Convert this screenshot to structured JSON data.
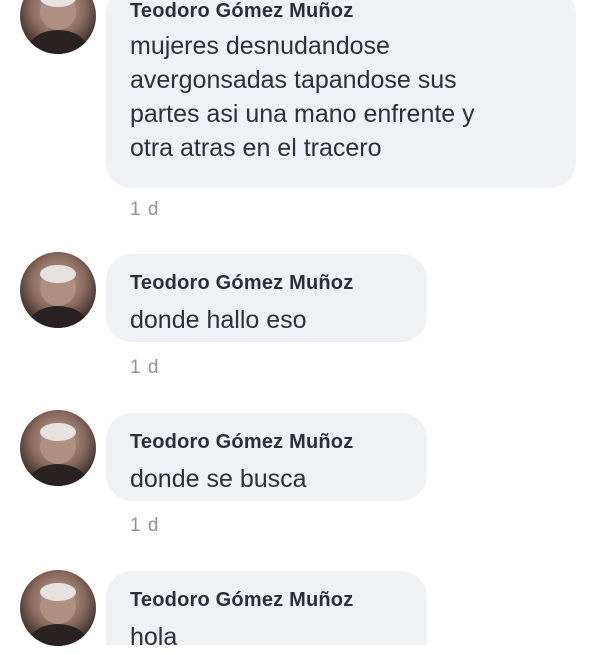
{
  "comments": [
    {
      "author": "Teodoro Gómez Muñoz",
      "text": "mujeres desnudandose\navergonsadas tapandose sus\npartes asi una mano enfrente y\notra atras en el tracero",
      "time": "1 d"
    },
    {
      "author": "Teodoro Gómez Muñoz",
      "text": "donde hallo eso",
      "time": "1 d"
    },
    {
      "author": "Teodoro Gómez Muñoz",
      "text": "donde se busca",
      "time": "1 d"
    },
    {
      "author": "Teodoro Gómez Muñoz",
      "text": "hola",
      "time": ""
    }
  ],
  "colors": {
    "bubble": "#f0f1f5",
    "author": "#2b2f38",
    "text": "#2d3038",
    "meta": "#8f949c"
  },
  "icons": {
    "avatar": "profile-photo"
  }
}
